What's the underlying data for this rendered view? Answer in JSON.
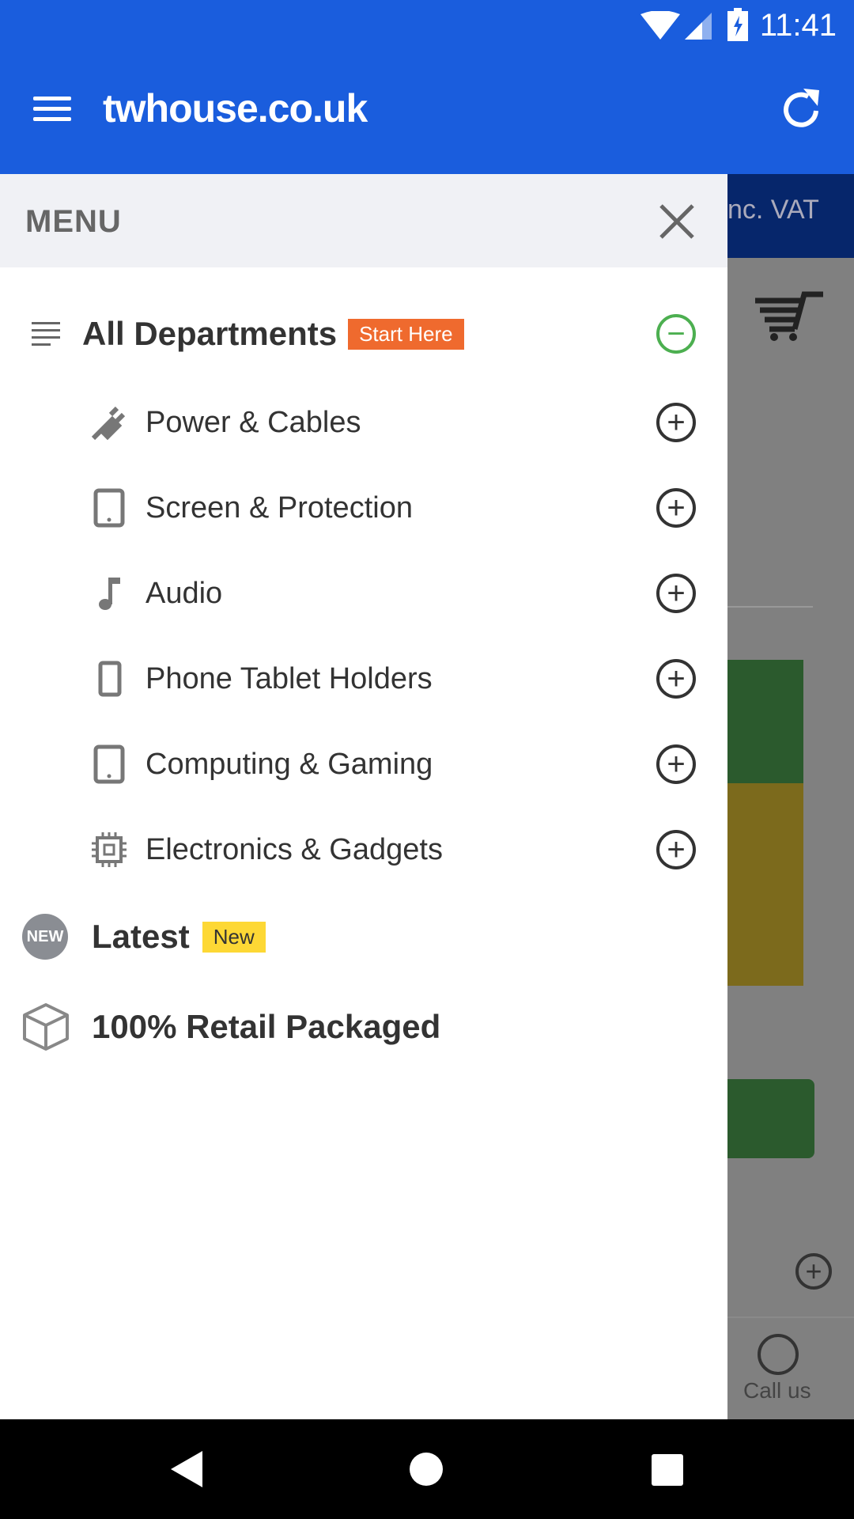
{
  "status": {
    "time": "11:41"
  },
  "toolbar": {
    "title": "twhouse.co.uk"
  },
  "background": {
    "vat_text": "nc. VAT",
    "call_label": "Call us"
  },
  "menu": {
    "title": "MENU",
    "all_departments": {
      "label": "All Departments",
      "badge": "Start Here",
      "badge_color": "#ef6a2e"
    },
    "items": [
      {
        "label": "Power & Cables",
        "icon": "plug-icon"
      },
      {
        "label": "Screen & Protection",
        "icon": "tablet-icon"
      },
      {
        "label": "Audio",
        "icon": "music-note-icon"
      },
      {
        "label": "Phone Tablet Holders",
        "icon": "phone-icon"
      },
      {
        "label": "Computing & Gaming",
        "icon": "tablet-icon"
      },
      {
        "label": "Electronics & Gadgets",
        "icon": "chip-icon"
      }
    ],
    "latest": {
      "label": "Latest",
      "badge": "New",
      "badge_color": "#fdd835",
      "icon_text": "NEW"
    },
    "retail": {
      "label": "100% Retail Packaged"
    }
  }
}
